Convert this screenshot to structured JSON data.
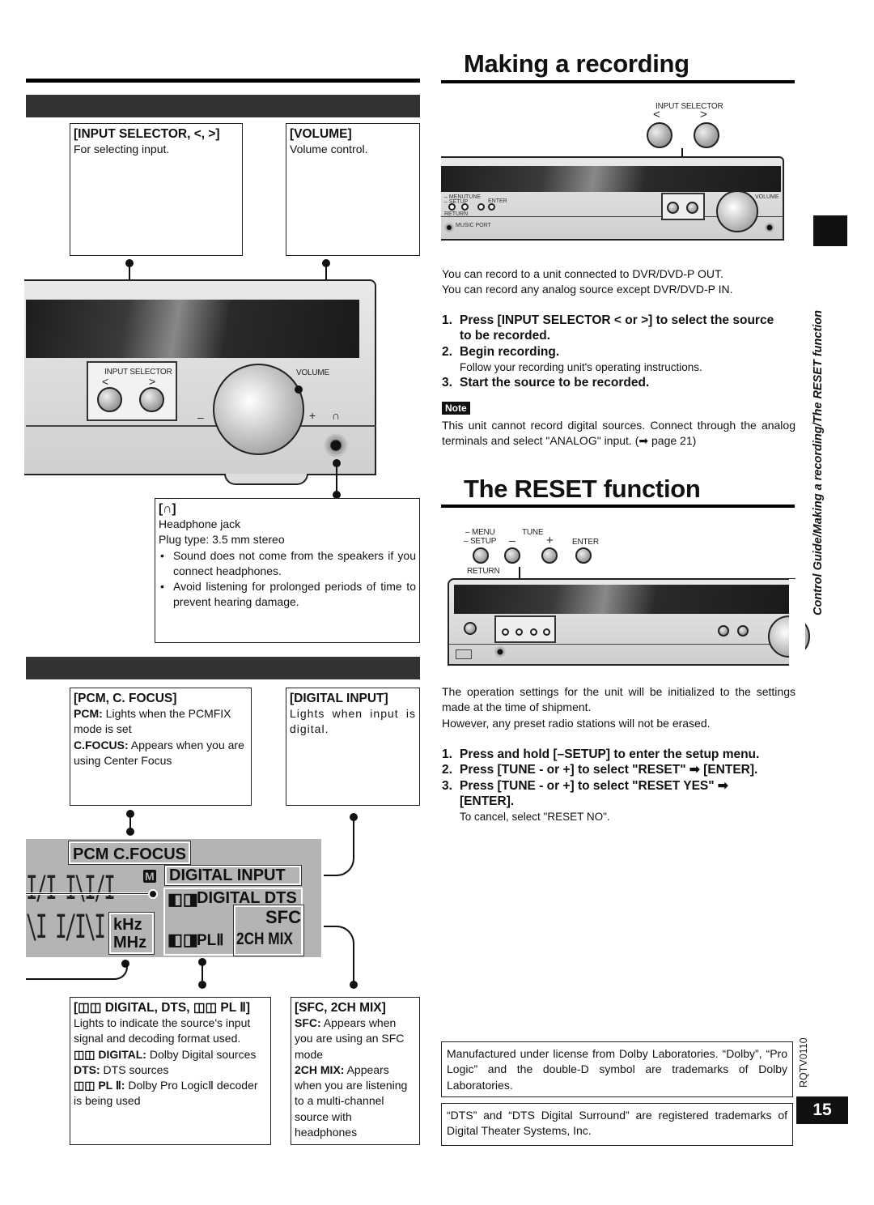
{
  "left": {
    "section1": {
      "boxes": [
        {
          "title": "[INPUT SELECTOR, <, >]",
          "text": "For selecting input."
        },
        {
          "title": "[VOLUME]",
          "text": "Volume control."
        }
      ],
      "device": {
        "input_selector_label": "INPUT SELECTOR",
        "left_arrow": "<",
        "right_arrow": ">",
        "volume_label": "VOLUME",
        "minus": "–",
        "plus": "+",
        "headphone_glyph": "∩"
      },
      "headphone_box": {
        "title": "[∩]",
        "lines": [
          "Headphone jack",
          "Plug type: 3.5 mm stereo"
        ],
        "bullets": [
          "Sound does not come from the speakers if you connect headphones.",
          "Avoid listening for prolonged periods of time to prevent hearing damage."
        ]
      }
    },
    "section2": {
      "boxes": [
        {
          "title": "[PCM, C. FOCUS]",
          "items": [
            {
              "term": "PCM:",
              "desc": " Lights when the PCMFIX mode is set"
            },
            {
              "term": "C.FOCUS:",
              "desc": " Appears when you are using Center Focus"
            }
          ]
        },
        {
          "title": "[DIGITAL INPUT]",
          "text": "Lights when input is digital."
        }
      ],
      "display": {
        "pcm_cfocus": "PCM C.FOCUS",
        "m_icon": "M",
        "digital_input": "DIGITAL  INPUT",
        "dolby_symbol": "◧◨",
        "digital_dts": "DIGITAL  DTS",
        "sfc": "SFC",
        "two_ch_mix": "2CH MIX",
        "khz": "kHz",
        "mhz": "MHz",
        "pl2": "PLⅡ",
        "seg_row1": "I/I  I\\I/I",
        "seg_row2": "\\I  I/I\\I"
      },
      "bottom_boxes": [
        {
          "title": "[◫◫ DIGITAL, DTS, ◫◫ PL Ⅱ]",
          "intro": "Lights to indicate the source's input signal and decoding format used.",
          "items": [
            {
              "term": "◫◫ DIGITAL:",
              "desc": " Dolby Digital sources"
            },
            {
              "term": "DTS:",
              "desc": " DTS sources"
            },
            {
              "term": "◫◫ PL Ⅱ:",
              "desc": " Dolby Pro LogicⅡ decoder is being used"
            }
          ]
        },
        {
          "title": "[SFC, 2CH MIX]",
          "items": [
            {
              "term": "SFC:",
              "desc": " Appears when you are using an SFC mode"
            },
            {
              "term": "2CH MIX:",
              "desc": " Appears when you are listening to a multi-channel source with headphones"
            }
          ]
        }
      ]
    }
  },
  "recording": {
    "title": "Making a recording",
    "device": {
      "input_selector_label": "INPUT SELECTOR",
      "left_arrow": "<",
      "right_arrow": ">",
      "menu": "– MENU",
      "setup": "– SETUP",
      "tune": "TUNE",
      "enter": "ENTER",
      "return": "RETURN",
      "music_port": "MUSIC PORT",
      "volume": "VOLUME"
    },
    "intro": [
      "You can record to a unit connected to DVR/DVD-P OUT.",
      "You can record any analog source except DVR/DVD-P IN."
    ],
    "steps": [
      {
        "num": "1.",
        "text": "Press [INPUT SELECTOR < or >] to select the source to be recorded."
      },
      {
        "num": "2.",
        "text": "Begin recording.",
        "sub": "Follow your recording unit's operating instructions."
      },
      {
        "num": "3.",
        "text": "Start the source to be recorded."
      }
    ],
    "note_label": "Note",
    "note_text": "This unit cannot record digital sources. Connect through the analog terminals and select \"ANALOG\" input. (➡ page 21)"
  },
  "reset": {
    "title": "The RESET function",
    "device": {
      "menu": "– MENU",
      "setup": "– SETUP",
      "tune": "TUNE",
      "minus": "–",
      "plus": "+",
      "enter": "ENTER",
      "return": "RETURN"
    },
    "intro": [
      "The operation settings for the unit will be initialized to the settings made at the time of shipment.",
      "However, any preset radio stations will not be erased."
    ],
    "steps": [
      {
        "num": "1.",
        "text": "Press and hold [–SETUP] to enter the setup menu."
      },
      {
        "num": "2.",
        "text": "Press [TUNE - or +] to select \"RESET\" ➡ [ENTER]."
      },
      {
        "num": "3.",
        "text": "Press [TUNE - or +] to select \"RESET YES\" ➡ [ENTER].",
        "sub": "To cancel, select \"RESET NO\"."
      }
    ]
  },
  "footer": {
    "dolby_notice": "Manufactured under license from Dolby Laboratories. “Dolby”, “Pro Logic” and the double-D symbol are trademarks of Dolby Laboratories.",
    "dts_notice": "“DTS” and “DTS Digital Surround” are registered trademarks of Digital Theater Systems, Inc.",
    "doc_code": "RQTV0110",
    "page_number": "15"
  },
  "side": {
    "section_path": "Control Guide/Making a recording/The RESET function"
  }
}
